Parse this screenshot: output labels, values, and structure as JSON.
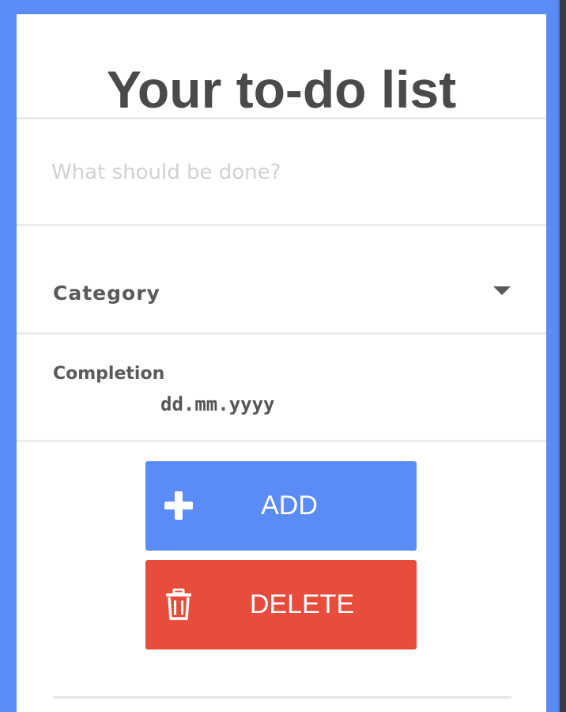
{
  "header": {
    "title": "Your to-do list"
  },
  "form": {
    "task_placeholder": "What should be done?",
    "category_label": "Category",
    "completion_label": "Completion",
    "date_placeholder": "dd.mm.yyyy"
  },
  "actions": {
    "add_label": "ADD",
    "delete_label": "DELETE",
    "add_icon": "plus-icon",
    "delete_icon": "trash-icon"
  },
  "colors": {
    "accent": "#5b8bf5",
    "danger": "#e74c3c",
    "text": "#4a4a4a",
    "placeholder": "#d2d2d2"
  }
}
